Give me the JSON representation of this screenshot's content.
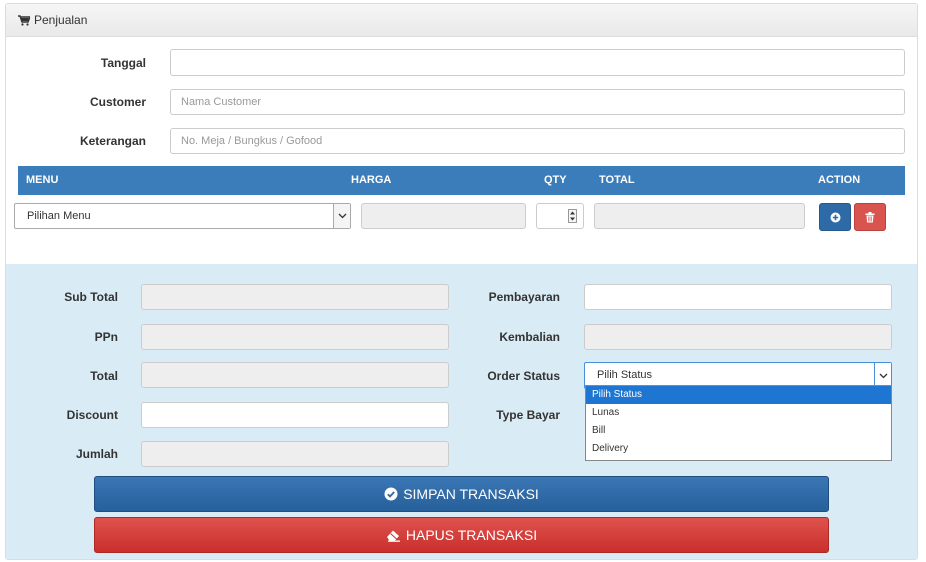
{
  "panel": {
    "title": "Penjualan"
  },
  "form": {
    "tanggal_label": "Tanggal",
    "tanggal_value": "",
    "customer_label": "Customer",
    "customer_placeholder": "Nama Customer",
    "keterangan_label": "Keterangan",
    "keterangan_placeholder": "No. Meja / Bungkus  / Gofood"
  },
  "table": {
    "headers": {
      "menu": "MENU",
      "harga": "HARGA",
      "qty": "QTY",
      "total": "TOTAL",
      "action": "ACTION"
    },
    "row": {
      "menu_selected": "Pilihan Menu",
      "harga": "",
      "qty": "",
      "total": ""
    }
  },
  "summary": {
    "sub_total_label": "Sub Total",
    "ppn_label": "PPn",
    "total_label": "Total",
    "discount_label": "Discount",
    "jumlah_label": "Jumlah",
    "pembayaran_label": "Pembayaran",
    "kembalian_label": "Kembalian",
    "order_status_label": "Order Status",
    "order_status_selected": "Pilih Status",
    "type_bayar_label": "Type Bayar",
    "order_status_options": [
      "Pilih Status",
      "Lunas",
      "Bill",
      "Delivery"
    ]
  },
  "buttons": {
    "simpan": "SIMPAN TRANSAKSI",
    "hapus": "HAPUS TRANSAKSI"
  },
  "colors": {
    "primary": "#3b7dbb",
    "danger": "#d9534f",
    "summary_bg": "#d9ebf5"
  }
}
